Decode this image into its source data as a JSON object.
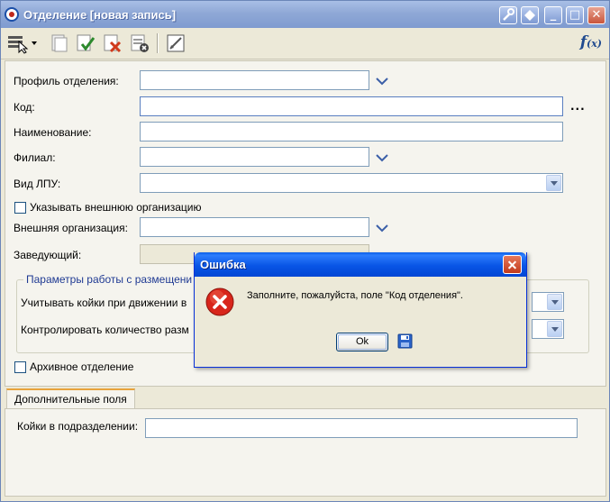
{
  "window": {
    "title": "Отделение [новая запись]",
    "buttons": {
      "min": "_",
      "max": "□",
      "close": "✕"
    }
  },
  "toolbar": {
    "icons": [
      "select-fields-icon",
      "copy-document-icon",
      "save-check-icon",
      "delete-icon",
      "cancel-icon",
      "edit-frame-icon"
    ],
    "fx_label": "f",
    "fx_sub": "(x)"
  },
  "form": {
    "profile_label": "Профиль отделения:",
    "code_label": "Код:",
    "name_label": "Наименование:",
    "branch_label": "Филиал:",
    "lpu_type_label": "Вид ЛПУ:",
    "external_org_checkbox_label": "Указывать внешнюю организацию",
    "external_org_label": "Внешняя организация:",
    "head_label": "Заведующий:",
    "params_group_title": "Параметры работы с размещени",
    "beds_label": "Учитывать койки при движении в",
    "control_label": "Контролировать количество разм",
    "archive_label": "Архивное отделение",
    "code_more": "..."
  },
  "tabs": {
    "additional_fields": "Дополнительные поля",
    "beds_in_unit_label": "Койки в подразделении:"
  },
  "dialog": {
    "title": "Ошибка",
    "message": "Заполните, пожалуйста, поле \"Код отделения\".",
    "ok_label": "Ok"
  }
}
